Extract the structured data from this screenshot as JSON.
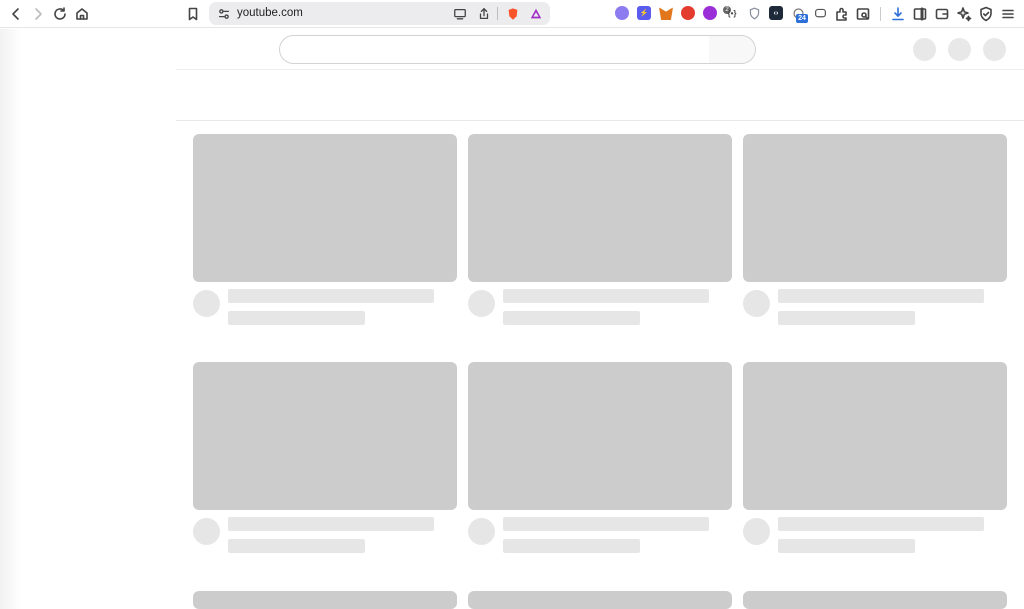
{
  "browser": {
    "url": "youtube.com",
    "brave_shield_count": "2",
    "extension_badge_count": "24",
    "extensions": [
      {
        "name": "ext-cloud-icon",
        "color": "#8c7cf0"
      },
      {
        "name": "ext-bolt-icon",
        "color": "#5a5cf0"
      },
      {
        "name": "metamask-icon",
        "color": "#e2761b"
      },
      {
        "name": "ext-red-icon",
        "color": "#e33b2e"
      },
      {
        "name": "ext-purple-icon",
        "color": "#9a2fd8"
      },
      {
        "name": "ext-brackets-icon",
        "color": "#444444"
      },
      {
        "name": "ext-shield-icon",
        "color": "#8a8fa0"
      },
      {
        "name": "ext-code-icon",
        "color": "#1e2a3a"
      },
      {
        "name": "ext-badge-icon",
        "color": "#777777"
      },
      {
        "name": "ext-chat-icon",
        "color": "#555555"
      }
    ]
  },
  "page": {
    "search_placeholder": "",
    "video_grid": {
      "rows": 3,
      "columns": 3,
      "state": "loading-skeleton"
    }
  },
  "colors": {
    "skeleton_thumb": "#cccccc",
    "skeleton_line": "#e6e6e6"
  }
}
